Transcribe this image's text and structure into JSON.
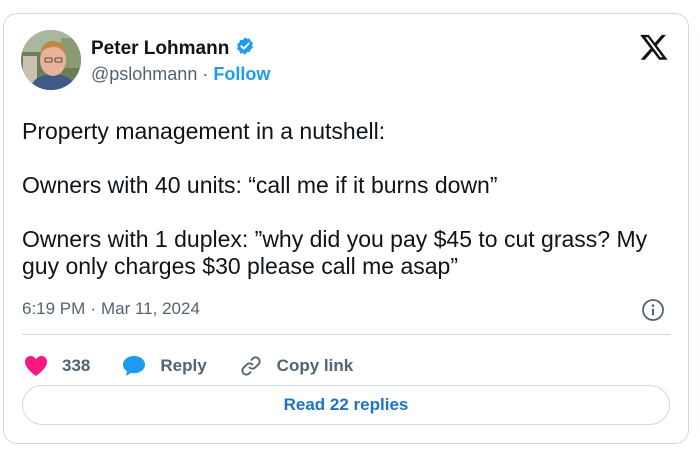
{
  "author": {
    "name": "Peter Lohmann",
    "handle": "@pslohmann",
    "separator": "·",
    "follow_label": "Follow"
  },
  "tweet": {
    "lines": [
      "Property management in a nutshell:",
      "Owners with 40 units: “call me if it burns down”",
      "Owners with 1 duplex: ”why did you pay $45 to cut grass? My guy only charges $30 please call me asap”"
    ],
    "time": "6:19 PM",
    "separator": "·",
    "date": "Mar 11, 2024"
  },
  "actions": {
    "likes_count": "338",
    "reply_label": "Reply",
    "copy_link_label": "Copy link"
  },
  "read_replies_label": "Read 22 replies",
  "icons": {
    "verified": "verified-badge-icon",
    "logo": "x-logo-icon",
    "info": "info-icon",
    "heart": "heart-icon",
    "reply": "reply-bubble-icon",
    "link": "link-icon"
  },
  "colors": {
    "verified": "#1d9bf0",
    "follow": "#1d9bf0",
    "heart": "#f91880",
    "reply_bubble": "#1d9bf0",
    "read_replies": "#1d73c8",
    "border": "#cfd9de",
    "secondary_text": "#536471"
  }
}
